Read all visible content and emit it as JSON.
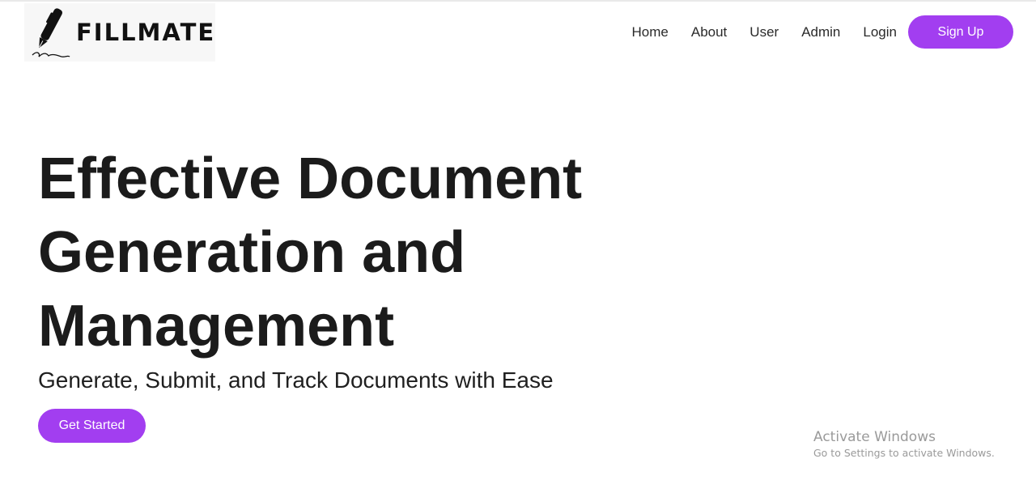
{
  "brand": {
    "name": "FILLMATE",
    "icon": "pen-icon"
  },
  "nav": {
    "items": [
      {
        "label": "Home"
      },
      {
        "label": "About"
      },
      {
        "label": "User"
      },
      {
        "label": "Admin"
      },
      {
        "label": "Login"
      }
    ],
    "signup_label": "Sign Up"
  },
  "hero": {
    "title_lines": [
      "Effective Document",
      "Generation and",
      "Management"
    ],
    "subtitle": "Generate, Submit, and Track Documents with Ease",
    "cta_label": "Get Started"
  },
  "watermark": {
    "title": "Activate Windows",
    "subtitle": "Go to Settings to activate Windows."
  },
  "colors": {
    "accent": "#a23ef0",
    "text": "#1b1b1b",
    "watermark": "#9a9a9a"
  }
}
